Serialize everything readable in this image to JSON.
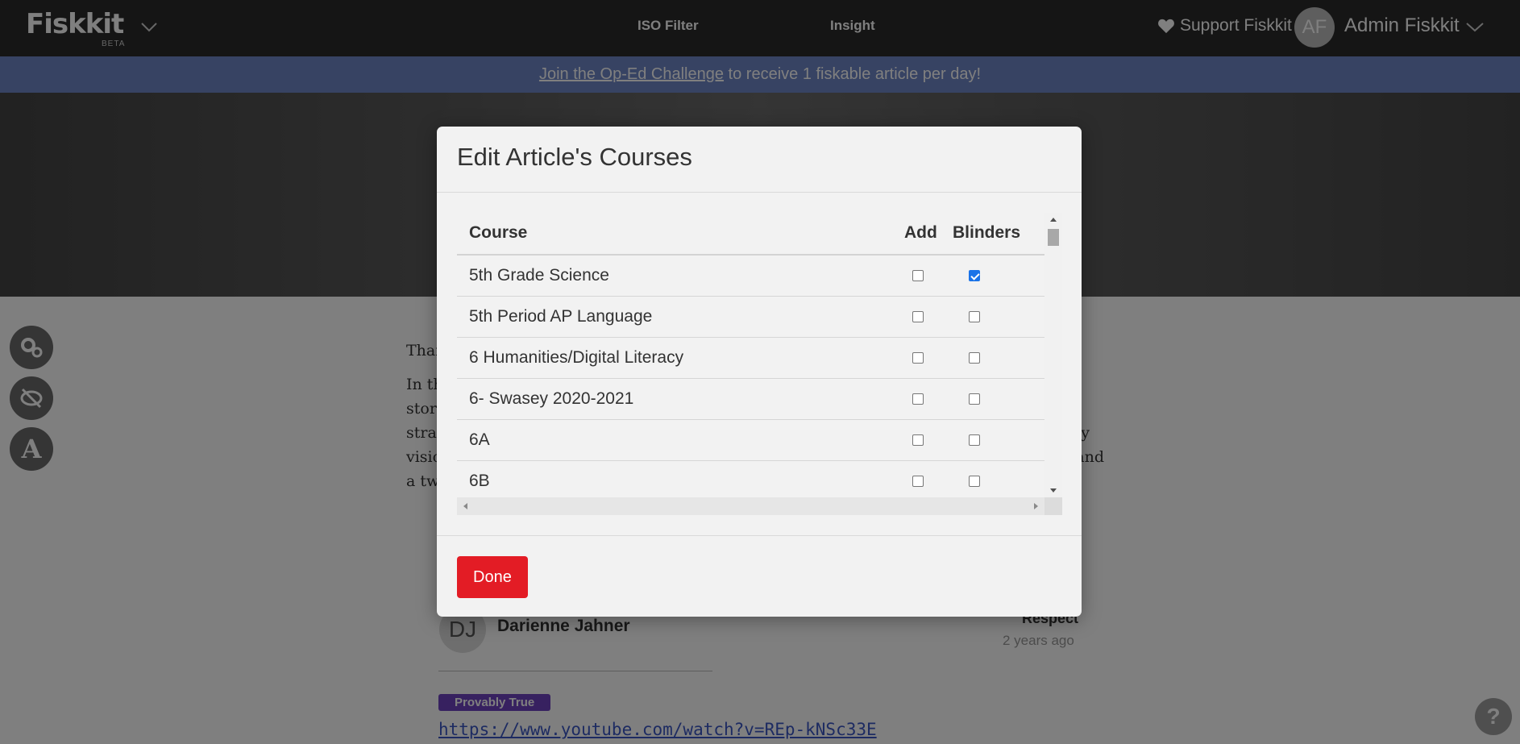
{
  "topbar": {
    "logo": "Fiskkit",
    "logo_sub": "BETA",
    "nav": [
      "ISO Filter",
      "Insight"
    ],
    "support": "Support Fiskkit",
    "avatar_initials": "AF",
    "user_name": "Admin Fiskkit"
  },
  "banner": {
    "link": "Join the Op-Ed Challenge",
    "text": " to receive 1 fiskable article per day!"
  },
  "article": {
    "p1": "Than",
    "p2_lines": [
      "In th",
      "store",
      "strai",
      "visio",
      "a tw"
    ],
    "p2_right": [
      "y",
      "and"
    ]
  },
  "side_tools": {
    "letter": "A"
  },
  "comment": {
    "avatar_initials": "DJ",
    "author": "Darienne Jahner",
    "respect": "Respect",
    "time": "2 years ago",
    "badge": "Provably True",
    "link": "https://www.youtube.com/watch?v=REp-kNSc33E"
  },
  "help": "?",
  "modal": {
    "title": "Edit Article's Courses",
    "columns": {
      "course": "Course",
      "add": "Add",
      "blinders": "Blinders"
    },
    "rows": [
      {
        "course": "5th Grade Science",
        "add": false,
        "blinders": true
      },
      {
        "course": "5th Period AP Language",
        "add": false,
        "blinders": false
      },
      {
        "course": "6 Humanities/Digital Literacy",
        "add": false,
        "blinders": false
      },
      {
        "course": "6- Swasey 2020-2021",
        "add": false,
        "blinders": false
      },
      {
        "course": "6A",
        "add": false,
        "blinders": false
      },
      {
        "course": "6B",
        "add": false,
        "blinders": false
      }
    ],
    "done": "Done"
  }
}
